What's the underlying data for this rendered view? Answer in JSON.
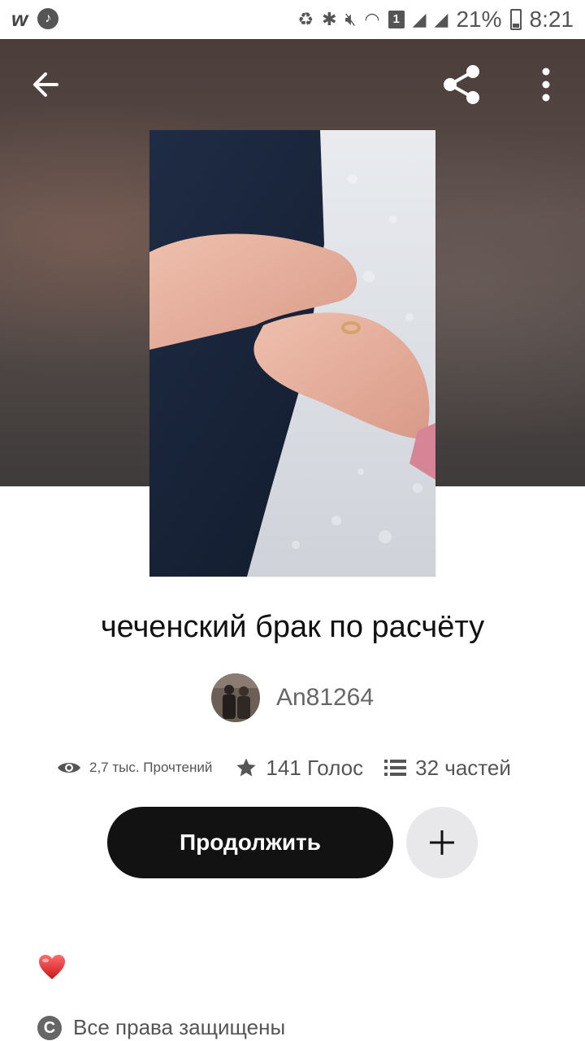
{
  "status_bar": {
    "battery": "21%",
    "time": "8:21",
    "sim_badge": "1",
    "left_icons": [
      "wattpad-icon",
      "music-icon"
    ],
    "right_icons": [
      "battery-saver-icon",
      "bluetooth-icon",
      "mute-icon",
      "wifi-icon",
      "sim-badge",
      "signal-icon",
      "signal-icon",
      "battery-icon"
    ]
  },
  "header": {
    "back_icon": "arrow-left-icon",
    "share_icon": "share-icon",
    "more_icon": "more-vertical-icon"
  },
  "story": {
    "title": "чеченский брак по расчёту",
    "author": "An81264",
    "stats": {
      "reads": "2,7 тыс. Прочтений",
      "votes": "141 Голос",
      "parts": "32 частей"
    }
  },
  "actions": {
    "continue_label": "Продолжить",
    "add_icon": "plus-icon"
  },
  "footer": {
    "heart_icon": "heart-icon",
    "rights_text": "Все права защищены",
    "rights_icon": "copyright-icon",
    "rights_glyph": "C"
  },
  "colors": {
    "button_dark": "#121212",
    "add_button_bg": "#e8e8ea",
    "heart": "#e0302e"
  }
}
